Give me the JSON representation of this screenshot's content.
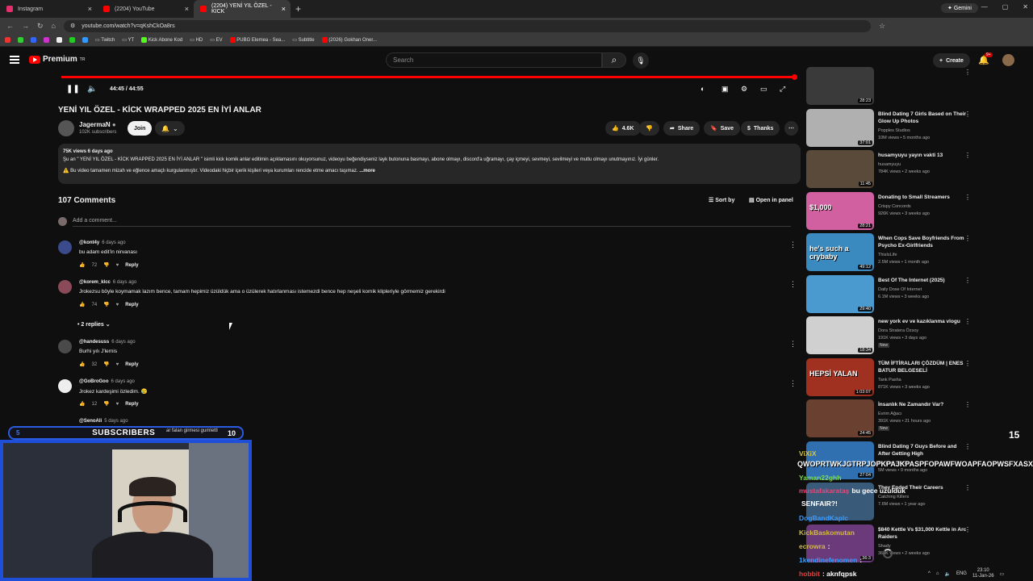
{
  "browser": {
    "tabs": [
      {
        "label": "Instagram"
      },
      {
        "label": "(2204) YouTube"
      },
      {
        "label": "(2204) YENİ YIL ÖZEL - KİCK"
      }
    ],
    "gemini_label": "Gemini",
    "url": "youtube.com/watch?v=qKshCkOa8rs",
    "bookmarks": [
      "Twitch",
      "YT",
      "Kick Abone Kod",
      "HD",
      "EV",
      "PUBG Elemea - Sea...",
      "Subtitle",
      "(2026) Gokhan Oner..."
    ]
  },
  "yt_header": {
    "logo": "Premium",
    "tm": "TR",
    "search_placeholder": "Search",
    "create_label": "Create",
    "notif_count": "9+"
  },
  "player": {
    "time": "44:45 / 44:55",
    "progress": 0.996
  },
  "video": {
    "title": "YENİ YIL ÖZEL - KİCK WRAPPED 2025 EN İYİ ANLAR",
    "channel": "JagermaN",
    "subscribers": "102K subscribers",
    "join": "Join",
    "likes": "4.6K",
    "share": "Share",
    "save": "Save",
    "thanks": "Thanks"
  },
  "description": {
    "stats": "75K views  6 days ago",
    "line1": "Şu an \" YENİ YIL ÖZEL - KİCK WRAPPED 2025 EN İYİ ANLAR \" isimli kick komik anlar editimin açıklamasını okuyorsunuz, videoyu beğendiyseniz layk butonuna basmayı, abone olmayı, discord'a uğramayı, çay içmeyi, sevmeyi, sevilmeyi ve mutlu olmayı unutmayınız. İyi günler.",
    "line2": "⚠️ Bu video tamamen mizah ve eğlence amaçlı kurgulanmıştır. Videodaki hiçbir içerik kişileri veya kurumları rencide etme amacı taşımaz.",
    "more": "...more"
  },
  "comments": {
    "count": "107 Comments",
    "sort_by": "Sort by",
    "open_panel": "Open in panel",
    "add_placeholder": "Add a comment...",
    "reply_label": "Reply",
    "items": [
      {
        "user": "@kont4y",
        "time": "6 days ago",
        "text": "bu adam edit'in nirvanası",
        "likes": "72"
      },
      {
        "user": "@korem_klcc",
        "time": "6 days ago",
        "text": "Jrokezsu böyle koymamak lazım bence, tamam hepimiz üzüldük ama o üzülerek hatırlanması istemezdi bence hep neşeli komik klipleriyle görmemiz gerekirdi",
        "likes": "74"
      },
      {
        "user": "@handesuss",
        "time": "6 days ago",
        "text": "Burhi yılı J'lernis",
        "likes": "32"
      },
      {
        "user": "@GoBroGoo",
        "time": "6 days ago",
        "text": "Jrokez kardeşimi özledim. 😢",
        "likes": "12"
      }
    ],
    "replies_label": "• 2 replies",
    "partial_user": "@SenoAli",
    "partial_time": "5 days ago"
  },
  "sidebar": {
    "videos": [
      {
        "title": "",
        "channel": "",
        "meta": "",
        "duration": "28:23"
      },
      {
        "title": "Blind Dating 7 Girls Based on Their Glow Up Photos",
        "channel": "Popples Studios",
        "meta": "10M views • 5 months ago",
        "duration": "37:01"
      },
      {
        "title": "husamyuyu yayın vakti 13",
        "channel": "husamyuyu",
        "meta": "784K views • 2 weeks ago",
        "duration": "11:45"
      },
      {
        "title": "Donating to Small Streamers",
        "channel": "Crispy Concords",
        "meta": "926K views • 3 weeks ago",
        "duration": "28:21",
        "thumb_text": "$1,000"
      },
      {
        "title": "When Cops Save Boyfriends From Psycho Ex-Girlfriends",
        "channel": "ThisIsLife",
        "meta": "2.5M views • 1 month ago",
        "duration": "49:12",
        "thumb_text": "he's such a crybaby"
      },
      {
        "title": "Best Of The Internet (2025)",
        "channel": "Daily Dose Of Internet",
        "meta": "6.1M views • 3 weeks ago",
        "duration": "29:40"
      },
      {
        "title": "new york ev ve kazıklanma vlogu",
        "channel": "Dora Stratera Özsoy",
        "meta": "191K views • 3 days ago",
        "duration": "18:34",
        "badge": "New"
      },
      {
        "title": "TÜM İFTİRALARI ÇÖZDÜM | ENES BATUR BELGESELİ",
        "channel": "Tank Pasha",
        "meta": "871K views • 3 weeks ago",
        "duration": "1:03:07",
        "thumb_text": "HEPSİ YALAN"
      },
      {
        "title": "İnsanlık Ne Zamandır Var?",
        "channel": "Evrim Ağacı",
        "meta": "391K views • 21 hours ago",
        "duration": "24:45",
        "badge": "New"
      },
      {
        "title": "Blind Dating 7 Guys Before and After Getting High",
        "channel": "Popples Studios",
        "meta": "5M views • 9 months ago",
        "duration": "27:04"
      },
      {
        "title": "They Ended Their Careers",
        "channel": "Catching Killers",
        "meta": "7.6M views • 1 year ago",
        "duration": ""
      },
      {
        "title": "$840 Kettle Vs $31,000 Kettle in Arc Raiders",
        "channel": "Shady",
        "meta": "368K views • 2 weeks ago",
        "duration": "36:3"
      }
    ]
  },
  "stream_overlay": {
    "left_num": "5",
    "label": "SUBSCRIBERS",
    "right_num": "10",
    "ticker": "ar falan girmesi gumlettl",
    "corner_num": "15",
    "big_text": "QWOPRTWKJGTRPJOPKPAJKPASPFOPAWFWOAPFAOPWSFXASX",
    "chat": [
      {
        "user": "ViXiX",
        "msg": "",
        "color": "#d4c24a"
      },
      {
        "user": "Yaman22ghh",
        "msg": "",
        "color": "#7ddc5a"
      },
      {
        "user": "mustafakarataş",
        "msg": "bu gece uzulduk",
        "color": "#e04a7a"
      },
      {
        "user": "",
        "msg": "SENFAIR?!",
        "color": "#ffffff"
      },
      {
        "user": "DogBandKaplc",
        "msg": "",
        "color": "#3a9bff"
      },
      {
        "user": "KickBaskomutan",
        "msg": "",
        "color": "#d4b84a"
      },
      {
        "user": "ecrowra",
        "msg": ":",
        "color": "#d4b84a"
      },
      {
        "user": "1kendinefenomen",
        "msg": ":",
        "color": "#3aa0ff"
      },
      {
        "user": "hobbit",
        "msg": ": aknfqpsk",
        "color": "#e04040"
      }
    ]
  },
  "taskbar": {
    "lang": "ENG",
    "time": "23:10",
    "date": "11-Jan-26"
  }
}
